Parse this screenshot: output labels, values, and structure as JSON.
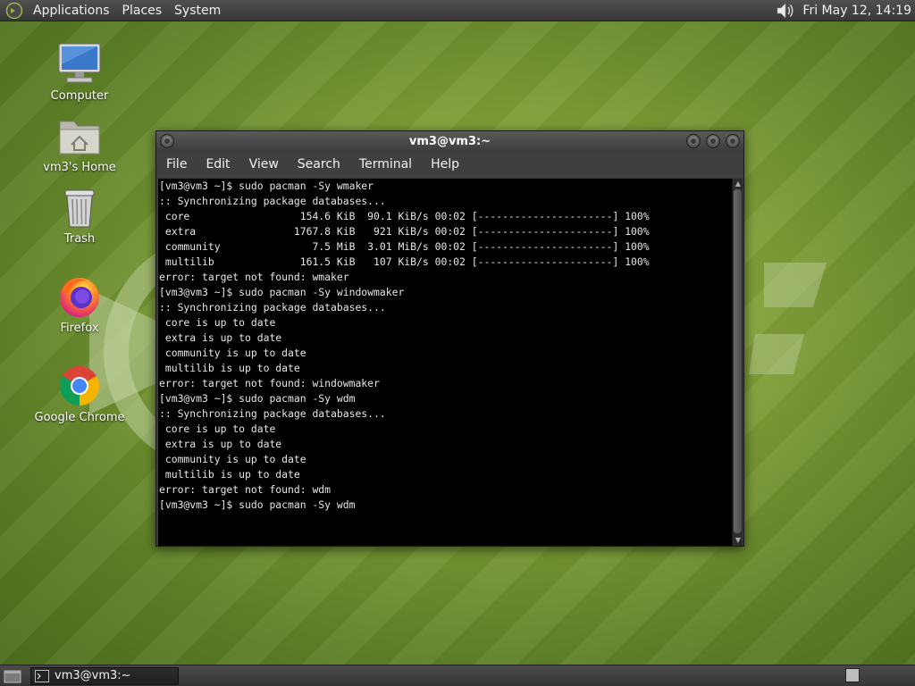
{
  "top_panel": {
    "menus": [
      "Applications",
      "Places",
      "System"
    ],
    "clock": "Fri May 12, 14:19",
    "menu_icon": "mate-logo-icon",
    "volume_icon": "volume-icon"
  },
  "desktop": {
    "icons": [
      {
        "label": "Computer",
        "icon": "computer-icon"
      },
      {
        "label": "vm3's Home",
        "icon": "home-folder-icon"
      },
      {
        "label": "Trash",
        "icon": "trash-icon"
      },
      {
        "label": "Firefox",
        "icon": "firefox-icon"
      },
      {
        "label": "Google Chrome",
        "icon": "chrome-icon"
      }
    ]
  },
  "terminal": {
    "title": "vm3@vm3:~",
    "menu": [
      "File",
      "Edit",
      "View",
      "Search",
      "Terminal",
      "Help"
    ],
    "lines": [
      "[vm3@vm3 ~]$ sudo pacman -Sy wmaker",
      ":: Synchronizing package databases...",
      " core                  154.6 KiB  90.1 KiB/s 00:02 [----------------------] 100%",
      " extra                1767.8 KiB   921 KiB/s 00:02 [----------------------] 100%",
      " community               7.5 MiB  3.01 MiB/s 00:02 [----------------------] 100%",
      " multilib              161.5 KiB   107 KiB/s 00:02 [----------------------] 100%",
      "error: target not found: wmaker",
      "[vm3@vm3 ~]$ sudo pacman -Sy windowmaker",
      ":: Synchronizing package databases...",
      " core is up to date",
      " extra is up to date",
      " community is up to date",
      " multilib is up to date",
      "error: target not found: windowmaker",
      "[vm3@vm3 ~]$ sudo pacman -Sy wdm",
      ":: Synchronizing package databases...",
      " core is up to date",
      " extra is up to date",
      " community is up to date",
      " multilib is up to date",
      "error: target not found: wdm",
      "[vm3@vm3 ~]$ sudo pacman -Sy wdm"
    ]
  },
  "bottom_panel": {
    "task": {
      "label": "vm3@vm3:~",
      "icon": "terminal-icon"
    },
    "show_desktop_icon": "show-desktop-icon",
    "workspace_icon": "workspace-switcher-icon"
  },
  "colors": {
    "desktop_green": "#84a13a",
    "panel_gray": "#3c3c3c",
    "terminal_bg": "#000000",
    "terminal_fg": "#e6e6e6"
  }
}
